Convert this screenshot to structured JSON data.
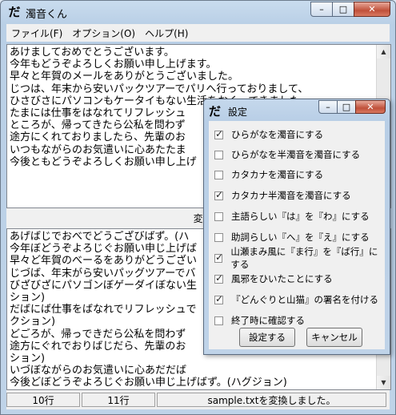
{
  "window": {
    "icon": "だ",
    "title": "濁音くん",
    "minimize_glyph": "–",
    "maximize_glyph": "□",
    "close_glyph": "✕"
  },
  "menu": [
    {
      "label": "ファイル(F)"
    },
    {
      "label": "オプション(O)"
    },
    {
      "label": "ヘルプ(H)"
    }
  ],
  "source_text": "あけましておめでとうございます。\n今年もどうぞよろしくお願い申し上げます。\n早々と年賀のメールをありがとうございました。\nじつは、年末から安いパックツアーでパリへ行っておりまして、\nひさびさにパソコンもケータイもない生活をおくってきました。\nたまには仕事をはなれてリフレッシュ\nところが、帰ってきたら公私を問わず\n途方にくれておりましたら、先輩のお\nいつもながらのお気遣いに心あたたま\n今後ともどうぞよろしくお願い申し上げ",
  "convert_label": "変換(",
  "result_text": "あげばじでおべでどうござびばず。(ハ\n今年ぼどうぞよろじぐお願い申じ上げば\n早々ど年賀のべーるをありがどうござい\nじづば、年末がら安いパッグツアーでバ\nびざびざにパソゴンぼゲーダイぼない生\nション)\nだばにば仕事をばなれでリフレッシュで\nクション)\nどごろが、帰っできだら公私を問わず\n途方にぐれでおりばじだら、先輩のお\nション)\nいづぼながらのお気遣いに心あだだば\n今後どぼどうぞよろじぐお願い申じ上げばず。(ハグジョン)\n山猫拝",
  "status": {
    "lines_source": "10行",
    "lines_result": "11行",
    "message": "sample.txtを変換しました。"
  },
  "settings_dialog": {
    "icon": "だ",
    "title": "設定",
    "options": [
      {
        "label": "ひらがなを濁音にする",
        "checked": true
      },
      {
        "label": "ひらがなを半濁音を濁音にする",
        "checked": false
      },
      {
        "label": "カタカナを濁音にする",
        "checked": false
      },
      {
        "label": "カタカナ半濁音を濁音にする",
        "checked": true
      },
      {
        "label": "主語らしい『は』を『わ』にする",
        "checked": false
      },
      {
        "label": "助詞らしい『へ』を『え』にする",
        "checked": false
      },
      {
        "label": "山瀬まみ風に『ま行』を『ば行』にする",
        "checked": true
      },
      {
        "label": "風邪をひいたことにする",
        "checked": true
      },
      {
        "label": "『どんぐりと山猫』の署名を付ける",
        "checked": true
      },
      {
        "label": "終了時に確認する",
        "checked": false
      }
    ],
    "ok_label": "設定する",
    "cancel_label": "キャンセル"
  }
}
